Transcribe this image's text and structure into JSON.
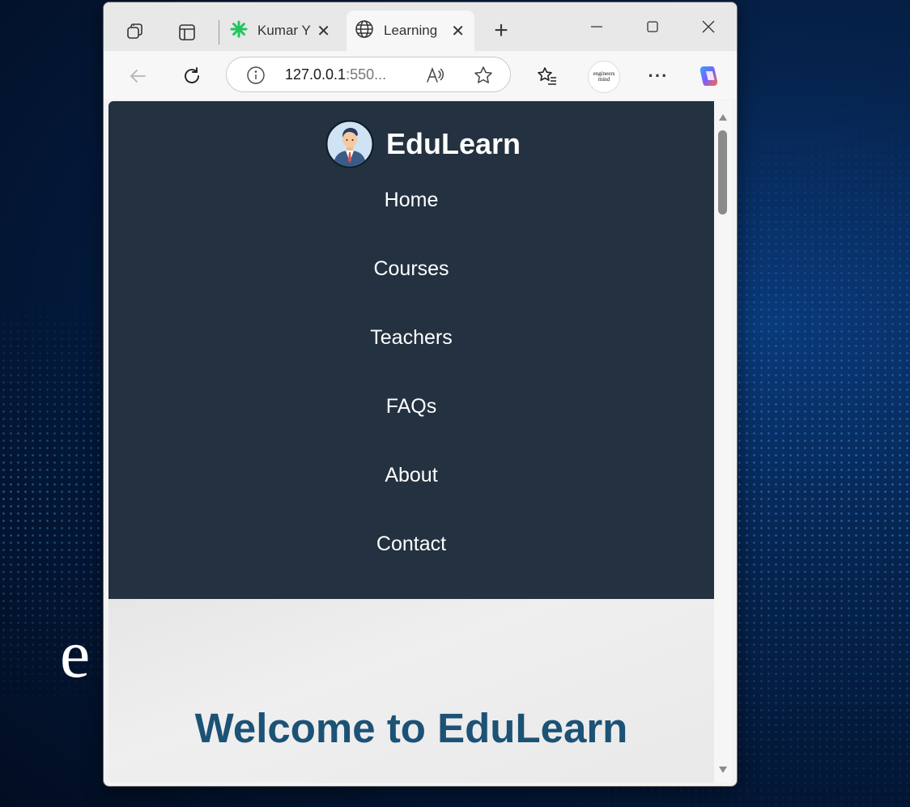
{
  "desktop": {
    "background_letter": "e"
  },
  "browser": {
    "tabs": [
      {
        "title": "Kumar Y",
        "icon": "asterisk-icon",
        "active": false
      },
      {
        "title": "Learning",
        "icon": "globe-icon",
        "active": true
      }
    ],
    "address": {
      "host": "127.0.0.1",
      "rest": ":550..."
    },
    "profile_text": "engineers mind"
  },
  "site": {
    "brand": "EduLearn",
    "nav": [
      "Home",
      "Courses",
      "Teachers",
      "FAQs",
      "About",
      "Contact"
    ],
    "hero_heading": "Welcome to EduLearn"
  },
  "colors": {
    "header_bg": "#233140",
    "heading": "#1c5276",
    "accent_copilot": "#3b82f6",
    "tab_icon_green": "#22c55e"
  }
}
